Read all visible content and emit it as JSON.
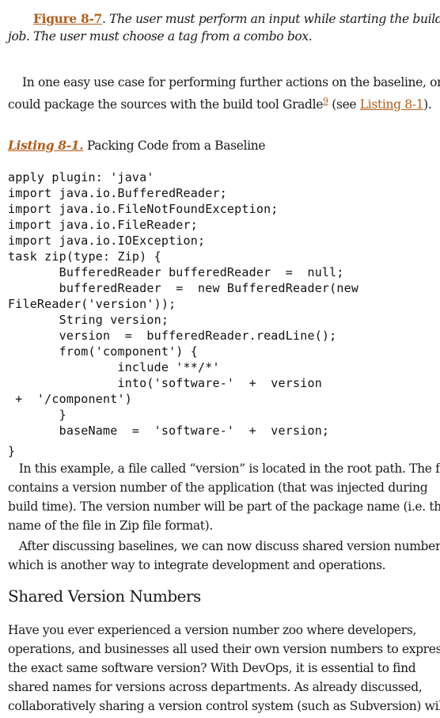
{
  "figure_caption": {
    "label": "Figure 8-7",
    "line1_rest": ". The user must perform an input while starting the build",
    "line2": "job. The user must choose a tag from a combo box."
  },
  "intro_paragraph": {
    "line1": "In one easy use case for performing further actions on the baseline, one",
    "line2_before": "could package the sources with the build tool Gradle",
    "footnote": "9",
    "line2_middle": " (see ",
    "listing_ref": "Listing 8-1",
    "line2_after": ")."
  },
  "listing": {
    "label": "Listing 8-1.",
    "title": " Packing Code from a Baseline",
    "code_lines": [
      "apply plugin: 'java'",
      "import java.io.BufferedReader;",
      "import java.io.FileNotFoundException;",
      "import java.io.FileReader;",
      "import java.io.IOException;",
      "task zip(type: Zip) {",
      "       BufferedReader bufferedReader  =  null;",
      "       bufferedReader  =  new BufferedReader(new",
      "FileReader('version'));",
      "       String version;",
      "       version  =  bufferedReader.readLine();",
      "       from('component') {",
      "               include '**/*'",
      "               into('software-'  +  version",
      " +  '/component')",
      "       }",
      "       baseName  =  'software-'  +  version;",
      "}"
    ]
  },
  "example_paragraph": {
    "lines": [
      "   In this example, a file called “version” is located in the root path. The file",
      "contains a version number of the application (that was injected during",
      "build time). The version number will be part of the package name (i.e. the",
      "name of the file in Zip file format)."
    ]
  },
  "baselines_paragraph": {
    "lines": [
      "   After discussing baselines, we can now discuss shared version numbers,",
      "which is another way to integrate development and operations."
    ]
  },
  "section_heading": "Shared Version Numbers",
  "shared_paragraph": {
    "lines": [
      "Have you ever experienced a version number zoo where developers,",
      "operations, and businesses all used their own version numbers to express",
      "the exact same software version? With DevOps, it is essential to find",
      "shared names for versions across departments. As already discussed,",
      "collaboratively sharing a version control system (such as Subversion) will"
    ]
  },
  "colors": {
    "link": "#b25f1c",
    "text": "#1a1a1a"
  }
}
